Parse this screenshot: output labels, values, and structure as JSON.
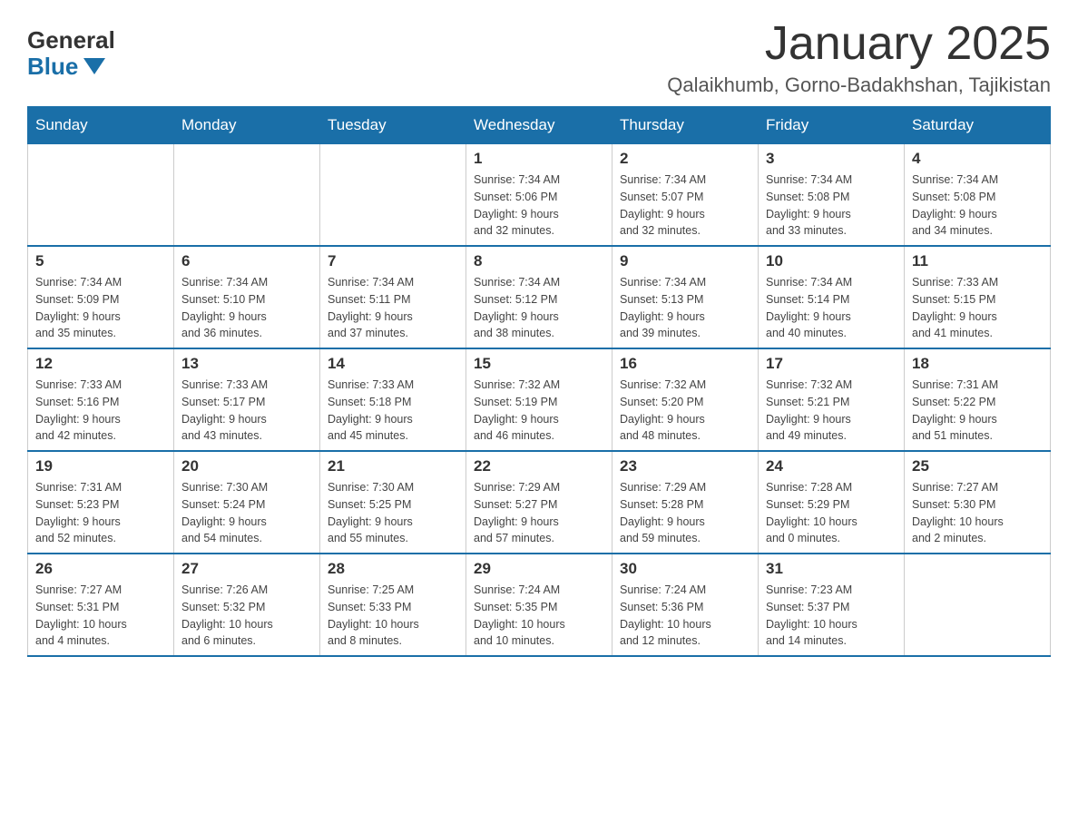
{
  "logo": {
    "general": "General",
    "blue": "Blue"
  },
  "title": "January 2025",
  "subtitle": "Qalaikhumb, Gorno-Badakhshan, Tajikistan",
  "days_of_week": [
    "Sunday",
    "Monday",
    "Tuesday",
    "Wednesday",
    "Thursday",
    "Friday",
    "Saturday"
  ],
  "weeks": [
    [
      {
        "day": "",
        "info": ""
      },
      {
        "day": "",
        "info": ""
      },
      {
        "day": "",
        "info": ""
      },
      {
        "day": "1",
        "info": "Sunrise: 7:34 AM\nSunset: 5:06 PM\nDaylight: 9 hours\nand 32 minutes."
      },
      {
        "day": "2",
        "info": "Sunrise: 7:34 AM\nSunset: 5:07 PM\nDaylight: 9 hours\nand 32 minutes."
      },
      {
        "day": "3",
        "info": "Sunrise: 7:34 AM\nSunset: 5:08 PM\nDaylight: 9 hours\nand 33 minutes."
      },
      {
        "day": "4",
        "info": "Sunrise: 7:34 AM\nSunset: 5:08 PM\nDaylight: 9 hours\nand 34 minutes."
      }
    ],
    [
      {
        "day": "5",
        "info": "Sunrise: 7:34 AM\nSunset: 5:09 PM\nDaylight: 9 hours\nand 35 minutes."
      },
      {
        "day": "6",
        "info": "Sunrise: 7:34 AM\nSunset: 5:10 PM\nDaylight: 9 hours\nand 36 minutes."
      },
      {
        "day": "7",
        "info": "Sunrise: 7:34 AM\nSunset: 5:11 PM\nDaylight: 9 hours\nand 37 minutes."
      },
      {
        "day": "8",
        "info": "Sunrise: 7:34 AM\nSunset: 5:12 PM\nDaylight: 9 hours\nand 38 minutes."
      },
      {
        "day": "9",
        "info": "Sunrise: 7:34 AM\nSunset: 5:13 PM\nDaylight: 9 hours\nand 39 minutes."
      },
      {
        "day": "10",
        "info": "Sunrise: 7:34 AM\nSunset: 5:14 PM\nDaylight: 9 hours\nand 40 minutes."
      },
      {
        "day": "11",
        "info": "Sunrise: 7:33 AM\nSunset: 5:15 PM\nDaylight: 9 hours\nand 41 minutes."
      }
    ],
    [
      {
        "day": "12",
        "info": "Sunrise: 7:33 AM\nSunset: 5:16 PM\nDaylight: 9 hours\nand 42 minutes."
      },
      {
        "day": "13",
        "info": "Sunrise: 7:33 AM\nSunset: 5:17 PM\nDaylight: 9 hours\nand 43 minutes."
      },
      {
        "day": "14",
        "info": "Sunrise: 7:33 AM\nSunset: 5:18 PM\nDaylight: 9 hours\nand 45 minutes."
      },
      {
        "day": "15",
        "info": "Sunrise: 7:32 AM\nSunset: 5:19 PM\nDaylight: 9 hours\nand 46 minutes."
      },
      {
        "day": "16",
        "info": "Sunrise: 7:32 AM\nSunset: 5:20 PM\nDaylight: 9 hours\nand 48 minutes."
      },
      {
        "day": "17",
        "info": "Sunrise: 7:32 AM\nSunset: 5:21 PM\nDaylight: 9 hours\nand 49 minutes."
      },
      {
        "day": "18",
        "info": "Sunrise: 7:31 AM\nSunset: 5:22 PM\nDaylight: 9 hours\nand 51 minutes."
      }
    ],
    [
      {
        "day": "19",
        "info": "Sunrise: 7:31 AM\nSunset: 5:23 PM\nDaylight: 9 hours\nand 52 minutes."
      },
      {
        "day": "20",
        "info": "Sunrise: 7:30 AM\nSunset: 5:24 PM\nDaylight: 9 hours\nand 54 minutes."
      },
      {
        "day": "21",
        "info": "Sunrise: 7:30 AM\nSunset: 5:25 PM\nDaylight: 9 hours\nand 55 minutes."
      },
      {
        "day": "22",
        "info": "Sunrise: 7:29 AM\nSunset: 5:27 PM\nDaylight: 9 hours\nand 57 minutes."
      },
      {
        "day": "23",
        "info": "Sunrise: 7:29 AM\nSunset: 5:28 PM\nDaylight: 9 hours\nand 59 minutes."
      },
      {
        "day": "24",
        "info": "Sunrise: 7:28 AM\nSunset: 5:29 PM\nDaylight: 10 hours\nand 0 minutes."
      },
      {
        "day": "25",
        "info": "Sunrise: 7:27 AM\nSunset: 5:30 PM\nDaylight: 10 hours\nand 2 minutes."
      }
    ],
    [
      {
        "day": "26",
        "info": "Sunrise: 7:27 AM\nSunset: 5:31 PM\nDaylight: 10 hours\nand 4 minutes."
      },
      {
        "day": "27",
        "info": "Sunrise: 7:26 AM\nSunset: 5:32 PM\nDaylight: 10 hours\nand 6 minutes."
      },
      {
        "day": "28",
        "info": "Sunrise: 7:25 AM\nSunset: 5:33 PM\nDaylight: 10 hours\nand 8 minutes."
      },
      {
        "day": "29",
        "info": "Sunrise: 7:24 AM\nSunset: 5:35 PM\nDaylight: 10 hours\nand 10 minutes."
      },
      {
        "day": "30",
        "info": "Sunrise: 7:24 AM\nSunset: 5:36 PM\nDaylight: 10 hours\nand 12 minutes."
      },
      {
        "day": "31",
        "info": "Sunrise: 7:23 AM\nSunset: 5:37 PM\nDaylight: 10 hours\nand 14 minutes."
      },
      {
        "day": "",
        "info": ""
      }
    ]
  ]
}
